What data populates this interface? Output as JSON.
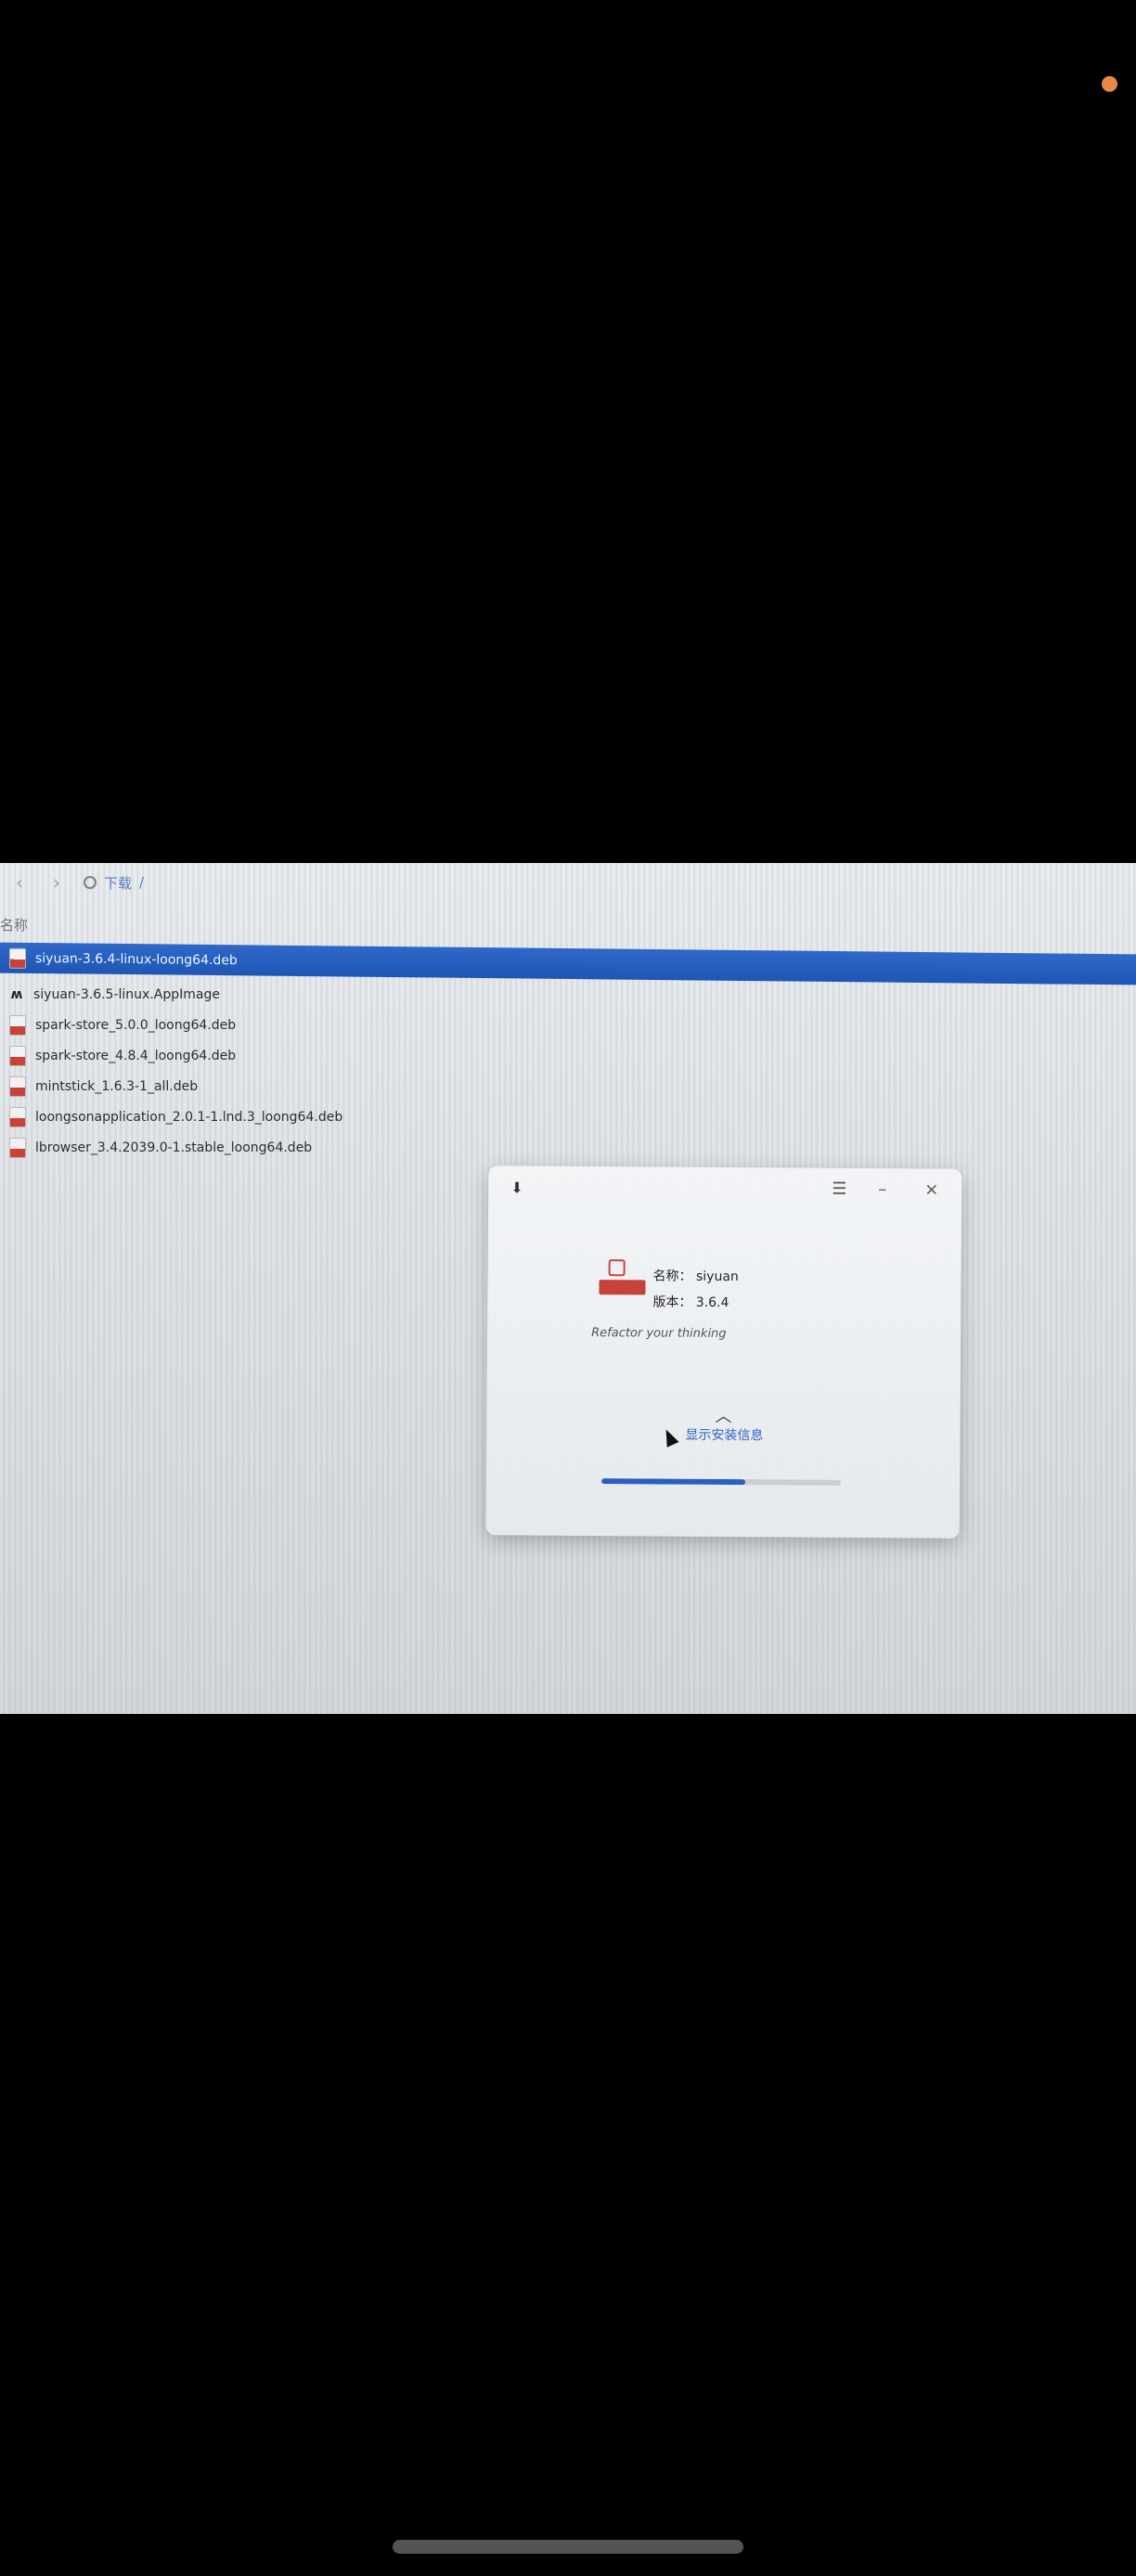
{
  "window": {
    "breadcrumb": "下载",
    "column_header": "名称"
  },
  "files": [
    {
      "name": "siyuan-3.6.4-linux-loong64.deb",
      "icon": "deb-package-icon",
      "selected": true
    },
    {
      "name": "siyuan-3.6.5-linux.AppImage",
      "icon": "appimage-icon",
      "selected": false
    },
    {
      "name": "spark-store_5.0.0_loong64.deb",
      "icon": "deb-package-icon",
      "selected": false
    },
    {
      "name": "spark-store_4.8.4_loong64.deb",
      "icon": "deb-package-icon",
      "selected": false
    },
    {
      "name": "mintstick_1.6.3-1_all.deb",
      "icon": "deb-package-icon",
      "selected": false
    },
    {
      "name": "loongsonapplication_2.0.1-1.lnd.3_loong64.deb",
      "icon": "deb-package-icon",
      "selected": false
    },
    {
      "name": "lbrowser_3.4.2039.0-1.stable_loong64.deb",
      "icon": "deb-package-icon",
      "selected": false
    }
  ],
  "dialog": {
    "name_line": "名称：  siyuan",
    "version_line": "版本：  3.6.4",
    "hint": "Refactor your thinking",
    "detail_link": "显示安装信息",
    "progress": 0.6
  },
  "colors": {
    "selection": "#1f56b6",
    "accent": "#2a5fc2",
    "deb_icon": "#c9423a",
    "status_dot": "#e8894a"
  }
}
